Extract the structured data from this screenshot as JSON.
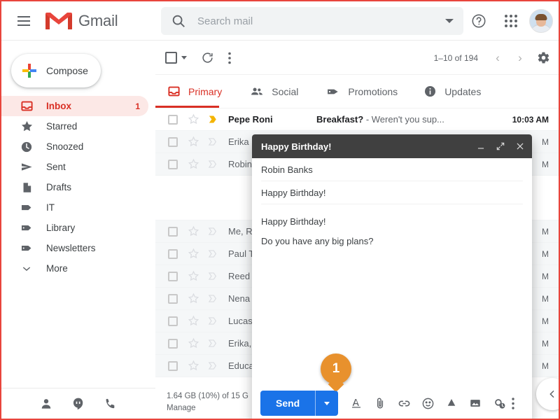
{
  "app": {
    "brand": "Gmail",
    "menu_icon": "hamburger-icon"
  },
  "search": {
    "placeholder": "Search mail",
    "value": "",
    "icon": "search-icon",
    "options_icon": "chevron-down-icon"
  },
  "topbar": {
    "help_icon": "help-icon",
    "apps_icon": "apps-grid-icon",
    "avatar": "user-avatar"
  },
  "sidebar": {
    "compose_label": "Compose",
    "items": [
      {
        "label": "Inbox",
        "icon": "inbox-icon",
        "count": "1",
        "active": true
      },
      {
        "label": "Starred",
        "icon": "star-icon",
        "count": "",
        "active": false
      },
      {
        "label": "Snoozed",
        "icon": "clock-icon",
        "count": "",
        "active": false
      },
      {
        "label": "Sent",
        "icon": "send-icon",
        "count": "",
        "active": false
      },
      {
        "label": "Drafts",
        "icon": "document-icon",
        "count": "",
        "active": false
      },
      {
        "label": "IT",
        "icon": "label-icon",
        "count": "",
        "active": false
      },
      {
        "label": "Library",
        "icon": "label-icon",
        "count": "",
        "active": false
      },
      {
        "label": "Newsletters",
        "icon": "label-icon",
        "count": "",
        "active": false
      },
      {
        "label": "More",
        "icon": "chevron-down-icon",
        "count": "",
        "active": false
      }
    ],
    "footer_icons": [
      "person-icon",
      "hangouts-icon",
      "phone-icon"
    ]
  },
  "toolbar": {
    "select_all_icon": "checkbox-icon",
    "select_caret_icon": "chevron-down-icon",
    "refresh_icon": "refresh-icon",
    "more_icon": "more-vertical-icon",
    "pager_text": "1–10 of 194",
    "prev_icon": "chevron-left-icon",
    "next_icon": "chevron-right-icon",
    "settings_icon": "gear-icon"
  },
  "tabs": [
    {
      "label": "Primary",
      "icon": "inbox-icon",
      "active": true
    },
    {
      "label": "Social",
      "icon": "people-icon",
      "active": false
    },
    {
      "label": "Promotions",
      "icon": "tag-icon",
      "active": false
    },
    {
      "label": "Updates",
      "icon": "info-icon",
      "active": false
    }
  ],
  "mail_rows": [
    {
      "sender": "Pepe Roni",
      "subject": "Breakfast?",
      "snippet": "- Weren't you sup...",
      "time": "10:03 AM",
      "unread": true,
      "spacer": false
    },
    {
      "sender": "Erika",
      "subject": "",
      "snippet": "",
      "time": "M",
      "unread": false,
      "spacer": false
    },
    {
      "sender": "Robin",
      "subject": "",
      "snippet": "",
      "time": "M",
      "unread": false,
      "spacer": false
    },
    {
      "sender": "",
      "subject": "",
      "snippet": "",
      "time": "",
      "unread": false,
      "spacer": true
    },
    {
      "sender": "Me, R",
      "subject": "",
      "snippet": "",
      "time": "M",
      "unread": false,
      "spacer": false
    },
    {
      "sender": "Paul T",
      "subject": "",
      "snippet": "",
      "time": "M",
      "unread": false,
      "spacer": false
    },
    {
      "sender": "Reed",
      "subject": "",
      "snippet": "",
      "time": "M",
      "unread": false,
      "spacer": false
    },
    {
      "sender": "Nena",
      "subject": "",
      "snippet": "",
      "time": "M",
      "unread": false,
      "spacer": false
    },
    {
      "sender": "Lucas",
      "subject": "",
      "snippet": "",
      "time": "M",
      "unread": false,
      "spacer": false
    },
    {
      "sender": "Erika,",
      "subject": "",
      "snippet": "",
      "time": "M",
      "unread": false,
      "spacer": false
    },
    {
      "sender": "Educa",
      "subject": "",
      "snippet": "",
      "time": "M",
      "unread": false,
      "spacer": false
    }
  ],
  "storage": {
    "line1": "1.64 GB (10%) of 15 G",
    "line2": "Manage"
  },
  "compose": {
    "title": "Happy Birthday!",
    "minimize_icon": "minimize-icon",
    "expand_icon": "expand-icon",
    "close_icon": "close-icon",
    "to_value": "Robin Banks",
    "subject_value": "Happy Birthday!",
    "body_line1": "Happy Birthday!",
    "body_line2": "Do you have any big plans?",
    "send_label": "Send",
    "send_caret_icon": "chevron-down-icon",
    "tools": [
      "format-text-icon",
      "attach-file-icon",
      "insert-link-icon",
      "insert-emoji-icon",
      "google-drive-icon",
      "insert-photo-icon",
      "confidential-mode-icon"
    ],
    "more_options_icon": "more-vertical-icon",
    "discard_icon": "trash-icon"
  },
  "marker": {
    "number": "1",
    "color": "#e8912d"
  },
  "fab": {
    "icon": "chevron-left-icon"
  },
  "colors": {
    "brand_red": "#e8453c",
    "accent_blue": "#1a73e8",
    "active_red": "#d93025",
    "marker_orange": "#e8912d",
    "compose_header": "#404040"
  }
}
